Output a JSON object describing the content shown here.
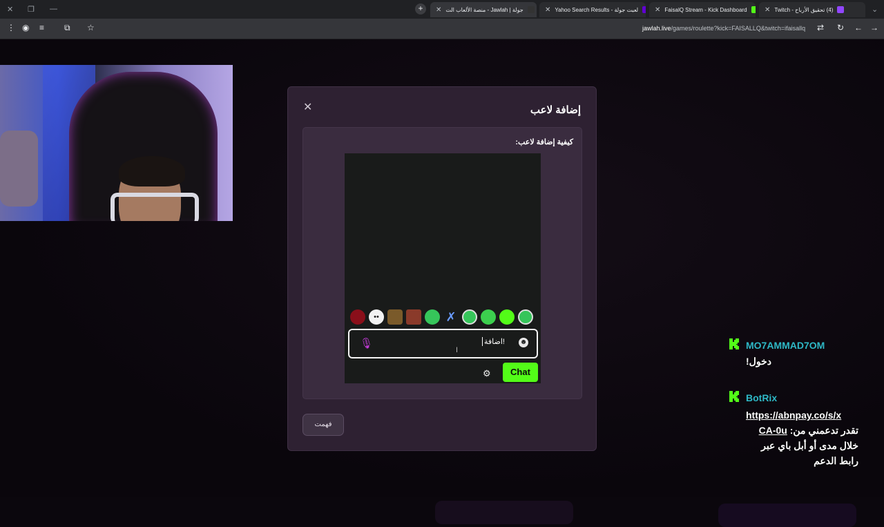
{
  "browser": {
    "tabs": [
      {
        "title": "جولة | Jawlah - منصة الألعاب الت",
        "active": true
      },
      {
        "title": "لعبت جولة - Yahoo Search Results",
        "active": false
      },
      {
        "title": "FaisalQ Stream - Kick Dashboard",
        "active": false
      },
      {
        "title": "(4) تحقيق الأرباح - Twitch",
        "active": false
      }
    ],
    "new_tab_symbol": "+",
    "url_host": "jawlah.live",
    "url_path": "/games/roulette?kick=FAISALLQ&twitch=ifaisallq"
  },
  "modal": {
    "title": "إضافة لاعب",
    "howto_title": "كيفية إضافة لاعب:",
    "chat_input_text": "!اضافة",
    "chat_button_label": "Chat",
    "understood_label": "فهمت",
    "close_symbol": "✕"
  },
  "overlay_chat": {
    "messages": [
      {
        "username": "MO7AMMAD7OM",
        "text": "دخول!"
      },
      {
        "username": "BotRix",
        "link_line1": "https://abnpay.co/s/x",
        "line2_link": "CA-0u",
        "line2_text": "تقدر تدعمني من:",
        "line3": "خلال مدى أو أبل باي عبر",
        "line4": "رابط الدعم"
      }
    ]
  },
  "colors": {
    "kick_green": "#53fc18",
    "username_teal": "#2eb8c6",
    "modal_bg": "#2e2132",
    "mic_purple": "#c23cd6"
  }
}
